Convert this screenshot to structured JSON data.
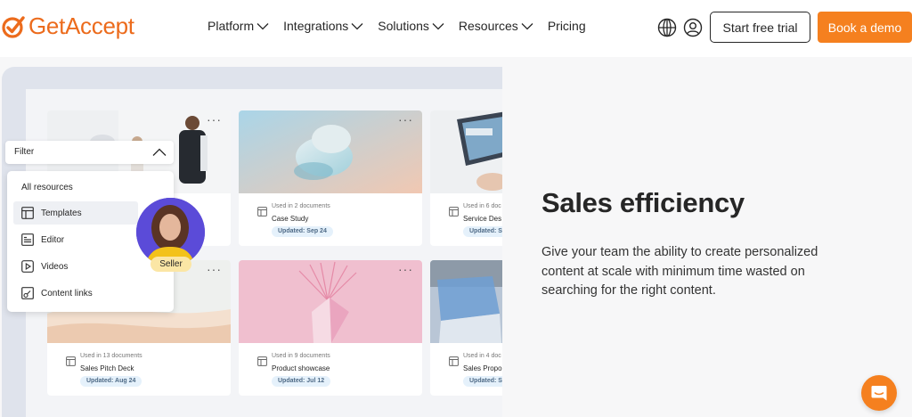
{
  "brand": {
    "name": "GetAccept",
    "color": "#ec6b1c",
    "accent": "#f5801f"
  },
  "nav": {
    "items": [
      {
        "label": "Platform",
        "dropdown": true
      },
      {
        "label": "Integrations",
        "dropdown": true
      },
      {
        "label": "Solutions",
        "dropdown": true
      },
      {
        "label": "Resources",
        "dropdown": true
      },
      {
        "label": "Pricing",
        "dropdown": false
      }
    ]
  },
  "header": {
    "globe_icon": "globe-icon",
    "user_icon": "user-icon",
    "trial_label": "Start free trial",
    "demo_label": "Book a demo"
  },
  "filter": {
    "label": "Filter",
    "menu_title": "All resources",
    "items": [
      {
        "label": "Templates",
        "icon": "template-icon",
        "selected": true
      },
      {
        "label": "Editor",
        "icon": "editor-icon"
      },
      {
        "label": "Videos",
        "icon": "video-icon"
      },
      {
        "label": "Content links",
        "icon": "link-doc-icon"
      }
    ]
  },
  "avatar": {
    "badge": "Seller"
  },
  "cards": [
    {
      "used": "",
      "name": "",
      "updated": ""
    },
    {
      "used": "Used in 2 documents",
      "name": "Case Study",
      "updated": "Updated: Sep 24"
    },
    {
      "used": "Used in 6 doc",
      "name": "Service Des",
      "updated": "Updated: Se"
    },
    {
      "used": "Used in 13 documents",
      "name": "Sales Pitch Deck",
      "updated": "Updated: Aug 24"
    },
    {
      "used": "Used in 9 documents",
      "name": "Product showcase",
      "updated": "Updated: Jul 12"
    },
    {
      "used": "Used in 4 doc",
      "name": "Sales Propo",
      "updated": "Updated: Se"
    }
  ],
  "card_menu_label": "···",
  "hero": {
    "title": "Sales efficiency",
    "description": "Give your team the ability to create personalized content at scale with minimum time wasted on searching for the right content."
  },
  "chat": {
    "icon": "chat-icon"
  }
}
